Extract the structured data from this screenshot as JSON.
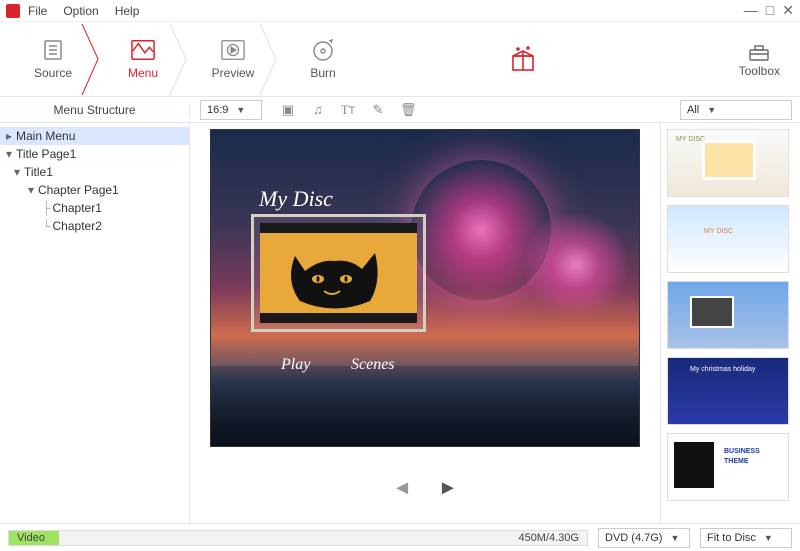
{
  "menubar": {
    "file": "File",
    "option": "Option",
    "help": "Help"
  },
  "steps": {
    "source": "Source",
    "menu": "Menu",
    "preview": "Preview",
    "burn": "Burn",
    "toolbox": "Toolbox"
  },
  "toolbar": {
    "structure_label": "Menu Structure",
    "aspect_ratio": "16:9",
    "template_filter": "All"
  },
  "tree": {
    "main_menu": "Main Menu",
    "title_page": "Title Page1",
    "title1": "Title1",
    "chapter_page": "Chapter Page1",
    "chapter1": "Chapter1",
    "chapter2": "Chapter2"
  },
  "canvas": {
    "disc_title": "My Disc",
    "play": "Play",
    "scenes": "Scenes"
  },
  "templates": {
    "t1_text": "MY DISC",
    "t2_text": "MY DISC",
    "t4_text": "My christmas holiday",
    "t5a": "BUSINESS",
    "t5b": "THEME"
  },
  "status": {
    "video_label": "Video",
    "usage": "450M/4.30G",
    "disc_type": "DVD (4.7G)",
    "fit": "Fit to Disc"
  }
}
